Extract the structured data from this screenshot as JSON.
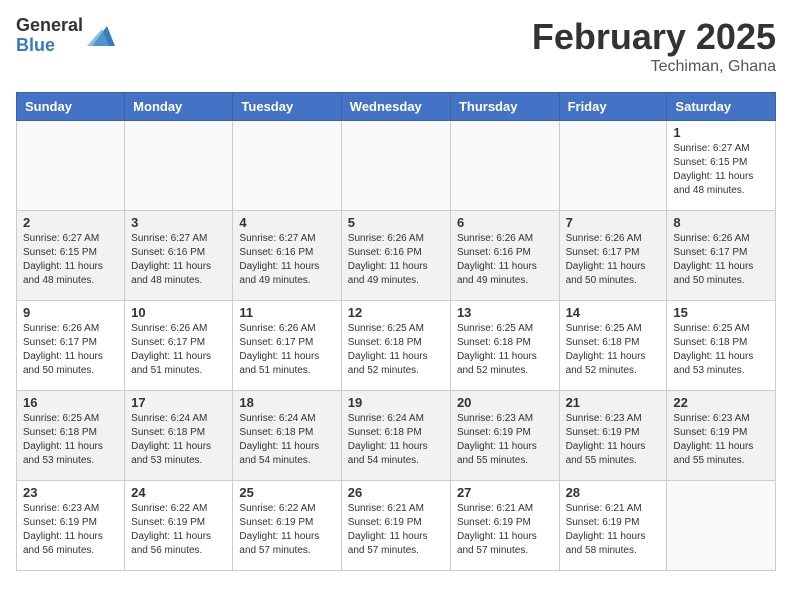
{
  "logo": {
    "general": "General",
    "blue": "Blue"
  },
  "title": "February 2025",
  "location": "Techiman, Ghana",
  "days_of_week": [
    "Sunday",
    "Monday",
    "Tuesday",
    "Wednesday",
    "Thursday",
    "Friday",
    "Saturday"
  ],
  "weeks": [
    [
      {
        "day": "",
        "info": ""
      },
      {
        "day": "",
        "info": ""
      },
      {
        "day": "",
        "info": ""
      },
      {
        "day": "",
        "info": ""
      },
      {
        "day": "",
        "info": ""
      },
      {
        "day": "",
        "info": ""
      },
      {
        "day": "1",
        "info": "Sunrise: 6:27 AM\nSunset: 6:15 PM\nDaylight: 11 hours\nand 48 minutes."
      }
    ],
    [
      {
        "day": "2",
        "info": "Sunrise: 6:27 AM\nSunset: 6:15 PM\nDaylight: 11 hours\nand 48 minutes."
      },
      {
        "day": "3",
        "info": "Sunrise: 6:27 AM\nSunset: 6:16 PM\nDaylight: 11 hours\nand 48 minutes."
      },
      {
        "day": "4",
        "info": "Sunrise: 6:27 AM\nSunset: 6:16 PM\nDaylight: 11 hours\nand 49 minutes."
      },
      {
        "day": "5",
        "info": "Sunrise: 6:26 AM\nSunset: 6:16 PM\nDaylight: 11 hours\nand 49 minutes."
      },
      {
        "day": "6",
        "info": "Sunrise: 6:26 AM\nSunset: 6:16 PM\nDaylight: 11 hours\nand 49 minutes."
      },
      {
        "day": "7",
        "info": "Sunrise: 6:26 AM\nSunset: 6:17 PM\nDaylight: 11 hours\nand 50 minutes."
      },
      {
        "day": "8",
        "info": "Sunrise: 6:26 AM\nSunset: 6:17 PM\nDaylight: 11 hours\nand 50 minutes."
      }
    ],
    [
      {
        "day": "9",
        "info": "Sunrise: 6:26 AM\nSunset: 6:17 PM\nDaylight: 11 hours\nand 50 minutes."
      },
      {
        "day": "10",
        "info": "Sunrise: 6:26 AM\nSunset: 6:17 PM\nDaylight: 11 hours\nand 51 minutes."
      },
      {
        "day": "11",
        "info": "Sunrise: 6:26 AM\nSunset: 6:17 PM\nDaylight: 11 hours\nand 51 minutes."
      },
      {
        "day": "12",
        "info": "Sunrise: 6:25 AM\nSunset: 6:18 PM\nDaylight: 11 hours\nand 52 minutes."
      },
      {
        "day": "13",
        "info": "Sunrise: 6:25 AM\nSunset: 6:18 PM\nDaylight: 11 hours\nand 52 minutes."
      },
      {
        "day": "14",
        "info": "Sunrise: 6:25 AM\nSunset: 6:18 PM\nDaylight: 11 hours\nand 52 minutes."
      },
      {
        "day": "15",
        "info": "Sunrise: 6:25 AM\nSunset: 6:18 PM\nDaylight: 11 hours\nand 53 minutes."
      }
    ],
    [
      {
        "day": "16",
        "info": "Sunrise: 6:25 AM\nSunset: 6:18 PM\nDaylight: 11 hours\nand 53 minutes."
      },
      {
        "day": "17",
        "info": "Sunrise: 6:24 AM\nSunset: 6:18 PM\nDaylight: 11 hours\nand 53 minutes."
      },
      {
        "day": "18",
        "info": "Sunrise: 6:24 AM\nSunset: 6:18 PM\nDaylight: 11 hours\nand 54 minutes."
      },
      {
        "day": "19",
        "info": "Sunrise: 6:24 AM\nSunset: 6:18 PM\nDaylight: 11 hours\nand 54 minutes."
      },
      {
        "day": "20",
        "info": "Sunrise: 6:23 AM\nSunset: 6:19 PM\nDaylight: 11 hours\nand 55 minutes."
      },
      {
        "day": "21",
        "info": "Sunrise: 6:23 AM\nSunset: 6:19 PM\nDaylight: 11 hours\nand 55 minutes."
      },
      {
        "day": "22",
        "info": "Sunrise: 6:23 AM\nSunset: 6:19 PM\nDaylight: 11 hours\nand 55 minutes."
      }
    ],
    [
      {
        "day": "23",
        "info": "Sunrise: 6:23 AM\nSunset: 6:19 PM\nDaylight: 11 hours\nand 56 minutes."
      },
      {
        "day": "24",
        "info": "Sunrise: 6:22 AM\nSunset: 6:19 PM\nDaylight: 11 hours\nand 56 minutes."
      },
      {
        "day": "25",
        "info": "Sunrise: 6:22 AM\nSunset: 6:19 PM\nDaylight: 11 hours\nand 57 minutes."
      },
      {
        "day": "26",
        "info": "Sunrise: 6:21 AM\nSunset: 6:19 PM\nDaylight: 11 hours\nand 57 minutes."
      },
      {
        "day": "27",
        "info": "Sunrise: 6:21 AM\nSunset: 6:19 PM\nDaylight: 11 hours\nand 57 minutes."
      },
      {
        "day": "28",
        "info": "Sunrise: 6:21 AM\nSunset: 6:19 PM\nDaylight: 11 hours\nand 58 minutes."
      },
      {
        "day": "",
        "info": ""
      }
    ]
  ]
}
